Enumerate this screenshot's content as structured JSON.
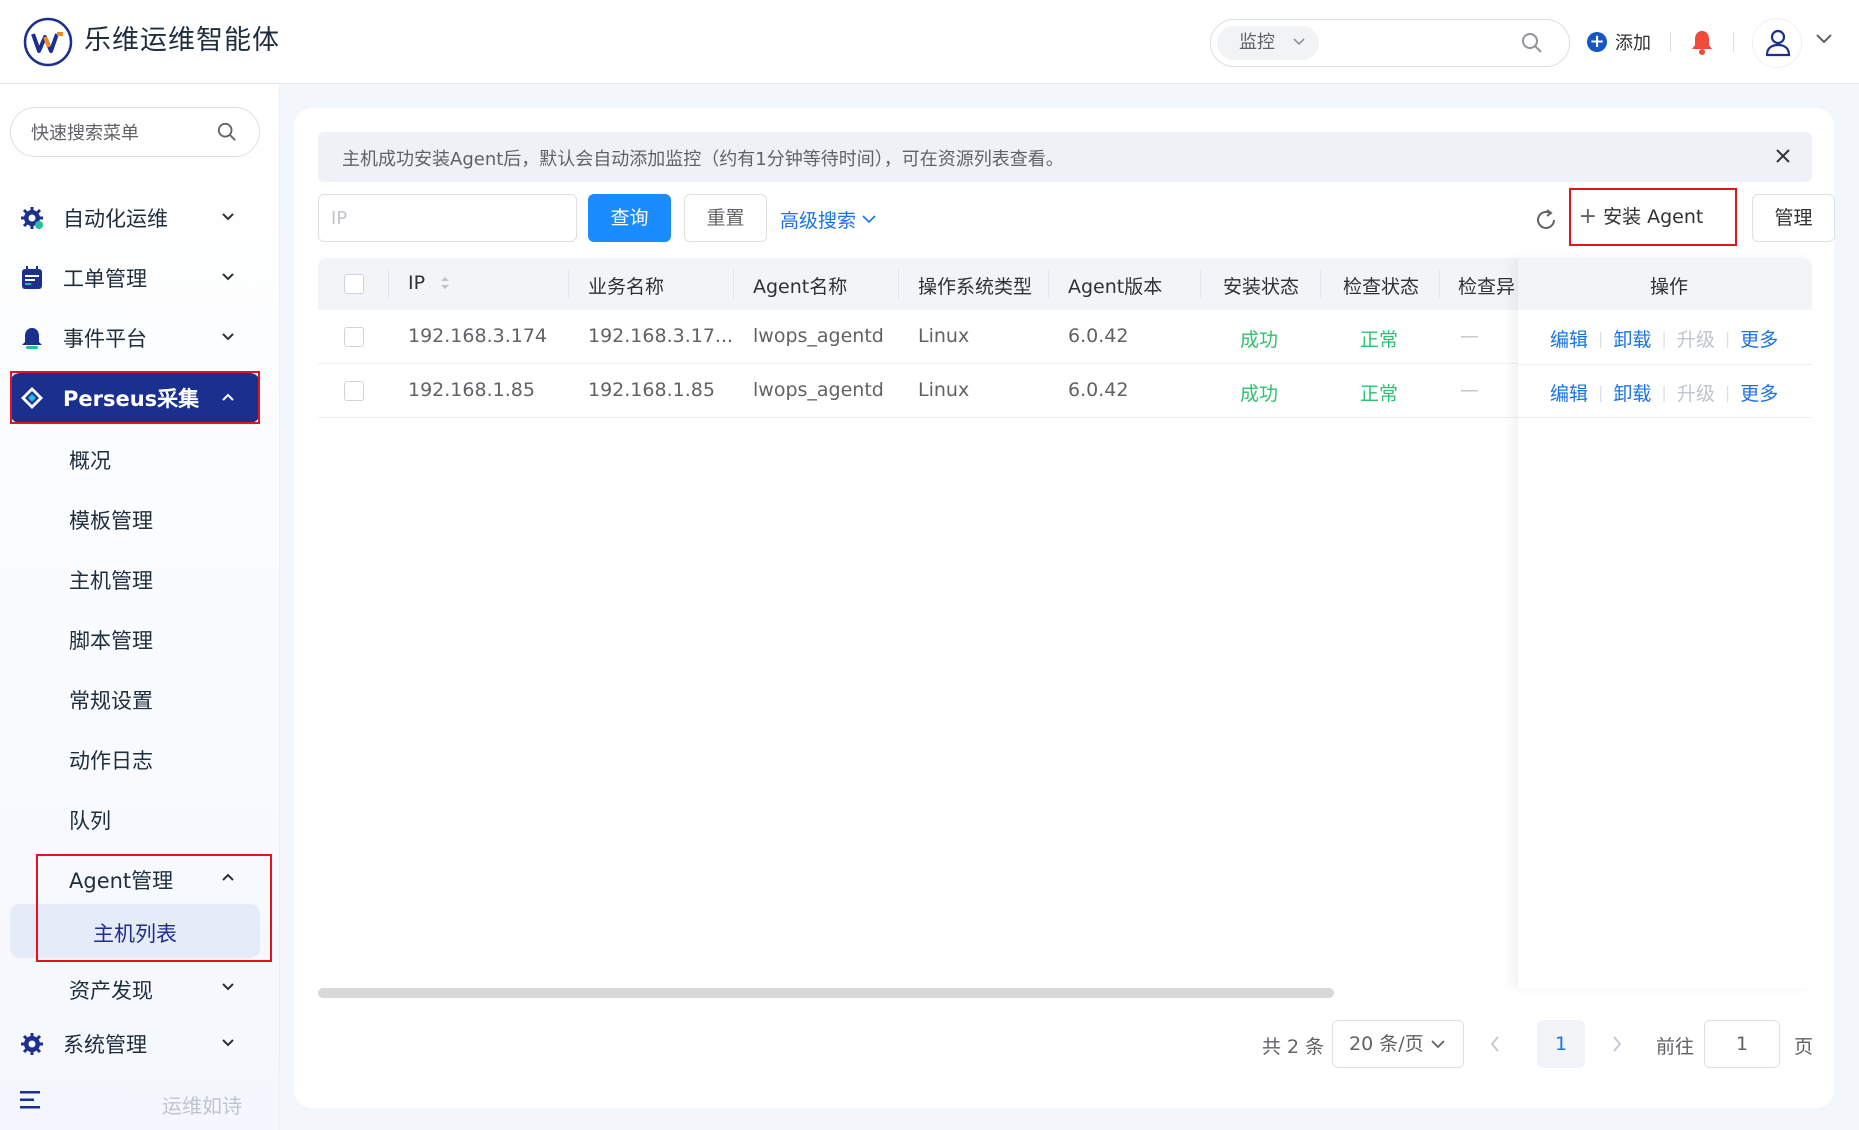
{
  "header": {
    "app_title": "乐维运维智能体",
    "search_scope": "监控",
    "add_label": "添加",
    "icons": [
      "logo",
      "chevron-down-icon",
      "search-icon",
      "plus-circle-icon",
      "bell-icon",
      "user-icon"
    ]
  },
  "sidebar": {
    "search_placeholder": "快速搜索菜单",
    "items": [
      {
        "label": "自动化运维",
        "icon": "gear-icon"
      },
      {
        "label": "工单管理",
        "icon": "calendar-icon"
      },
      {
        "label": "事件平台",
        "icon": "bell-icon"
      },
      {
        "label": "Perseus采集",
        "icon": "diamond-icon",
        "active": true
      },
      {
        "label": "系统管理",
        "icon": "gear-icon"
      }
    ],
    "perseus_sub": [
      "概况",
      "模板管理",
      "主机管理",
      "脚本管理",
      "常规设置",
      "动作日志",
      "队列"
    ],
    "agent_menu": {
      "label": "Agent管理",
      "child": "主机列表"
    },
    "asset_discovery": "资产发现",
    "footer_text": "运维如诗"
  },
  "main": {
    "notice": "主机成功安装Agent后，默认会自动添加监控（约有1分钟等待时间），可在资源列表查看。",
    "ip_placeholder": "IP",
    "query_label": "查询",
    "reset_label": "重置",
    "advanced_label": "高级搜索",
    "install_label": "安装 Agent",
    "manage_label": "管理"
  },
  "table": {
    "columns": [
      "IP",
      "业务名称",
      "Agent名称",
      "操作系统类型",
      "Agent版本",
      "安装状态",
      "检查状态",
      "检查异",
      "操作"
    ],
    "rows": [
      {
        "ip": "192.168.3.174",
        "biz": "192.168.3.17...",
        "agent": "lwops_agentd",
        "os": "Linux",
        "version": "6.0.42",
        "install": "成功",
        "check": "正常",
        "error": "—"
      },
      {
        "ip": "192.168.1.85",
        "biz": "192.168.1.85",
        "agent": "lwops_agentd",
        "os": "Linux",
        "version": "6.0.42",
        "install": "成功",
        "check": "正常",
        "error": "—"
      }
    ],
    "actions": [
      "编辑",
      "卸载",
      "升级",
      "更多"
    ]
  },
  "pagination": {
    "total": "共 2 条",
    "page_size": "20 条/页",
    "current": "1",
    "goto_label": "前往",
    "goto_value": "1",
    "suffix": "页"
  },
  "colors": {
    "primary": "#1a8cff",
    "sidebar_active": "#1b2f8f",
    "success": "#30c070",
    "highlight": "#e0151f"
  }
}
